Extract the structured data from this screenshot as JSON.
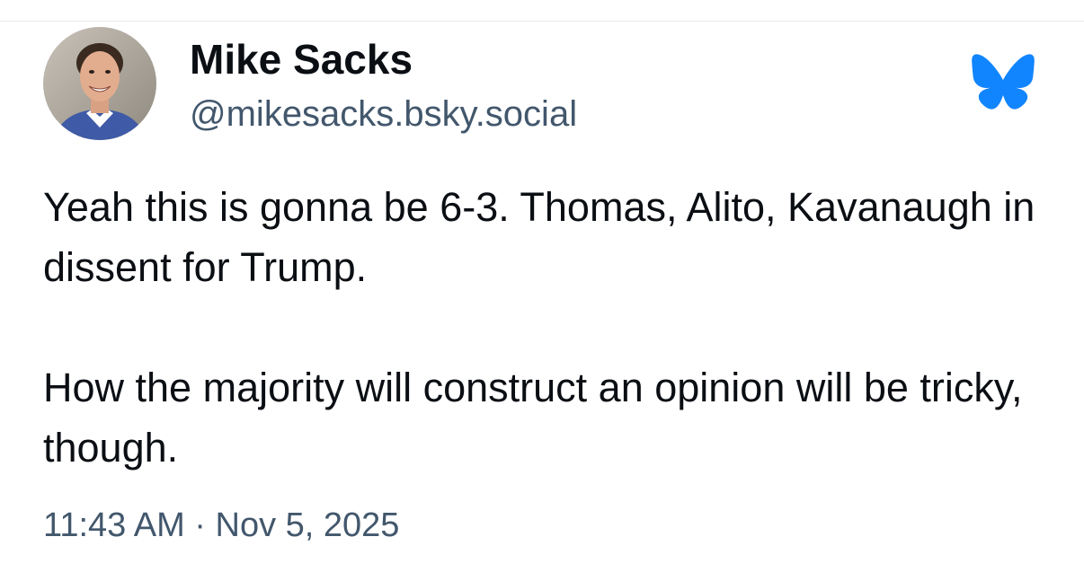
{
  "post": {
    "author": {
      "display_name": "Mike Sacks",
      "handle": "@mikesacks.bsky.social",
      "avatar": "profile-photo"
    },
    "paragraphs": [
      "Yeah this is gonna be 6-3. Thomas, Alito, Kavanaugh in dissent for Trump.",
      "How the majority will construct an opinion will be tricky, though."
    ],
    "timestamp": "11:43 AM · Nov 5, 2025"
  },
  "brand": {
    "icon": "bluesky-butterfly-icon",
    "color": "#1185fe"
  },
  "colors": {
    "text": "#0b0f14",
    "secondary_text": "#42576c"
  }
}
